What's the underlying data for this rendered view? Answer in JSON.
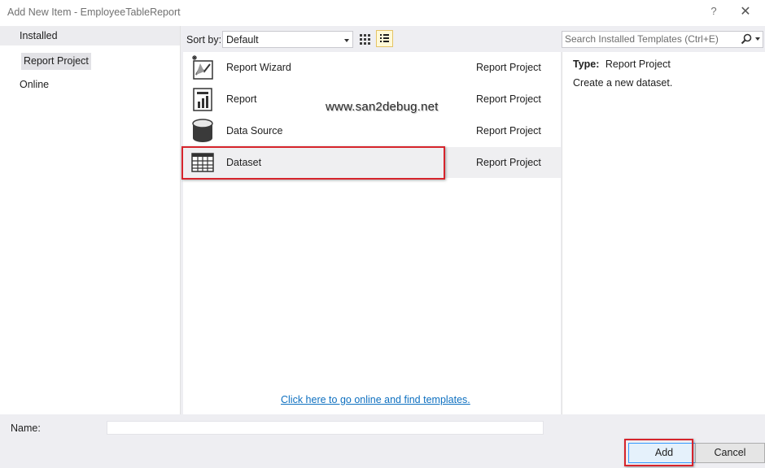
{
  "window": {
    "title": "Add New Item - EmployeeTableReport",
    "help_glyph": "?",
    "close_glyph": "✕"
  },
  "tree": {
    "installed_label": "Installed",
    "child_label": "Report Project",
    "online_label": "Online"
  },
  "toolbar": {
    "sort_label": "Sort by:",
    "sort_value": "Default",
    "search_placeholder": "Search Installed Templates (Ctrl+E)"
  },
  "templates": [
    {
      "name": "Report Wizard",
      "type": "Report Project",
      "icon": "report-wizard-icon",
      "selected": false
    },
    {
      "name": "Report",
      "type": "Report Project",
      "icon": "report-icon",
      "selected": false
    },
    {
      "name": "Data Source",
      "type": "Report Project",
      "icon": "data-source-icon",
      "selected": false
    },
    {
      "name": "Dataset",
      "type": "Report Project",
      "icon": "dataset-icon",
      "selected": true
    }
  ],
  "online_link": "Click here to go online and find templates.",
  "watermark": "www.san2debug.net",
  "details": {
    "type_label": "Type:",
    "type_value": "Report Project",
    "description": "Create a new dataset."
  },
  "bottom": {
    "name_label": "Name:",
    "name_value": "",
    "add_label": "Add",
    "cancel_label": "Cancel"
  },
  "colors": {
    "highlight_box": "#d6242c",
    "link": "#0e70c0",
    "dialog_bg": "#eeeef2"
  }
}
